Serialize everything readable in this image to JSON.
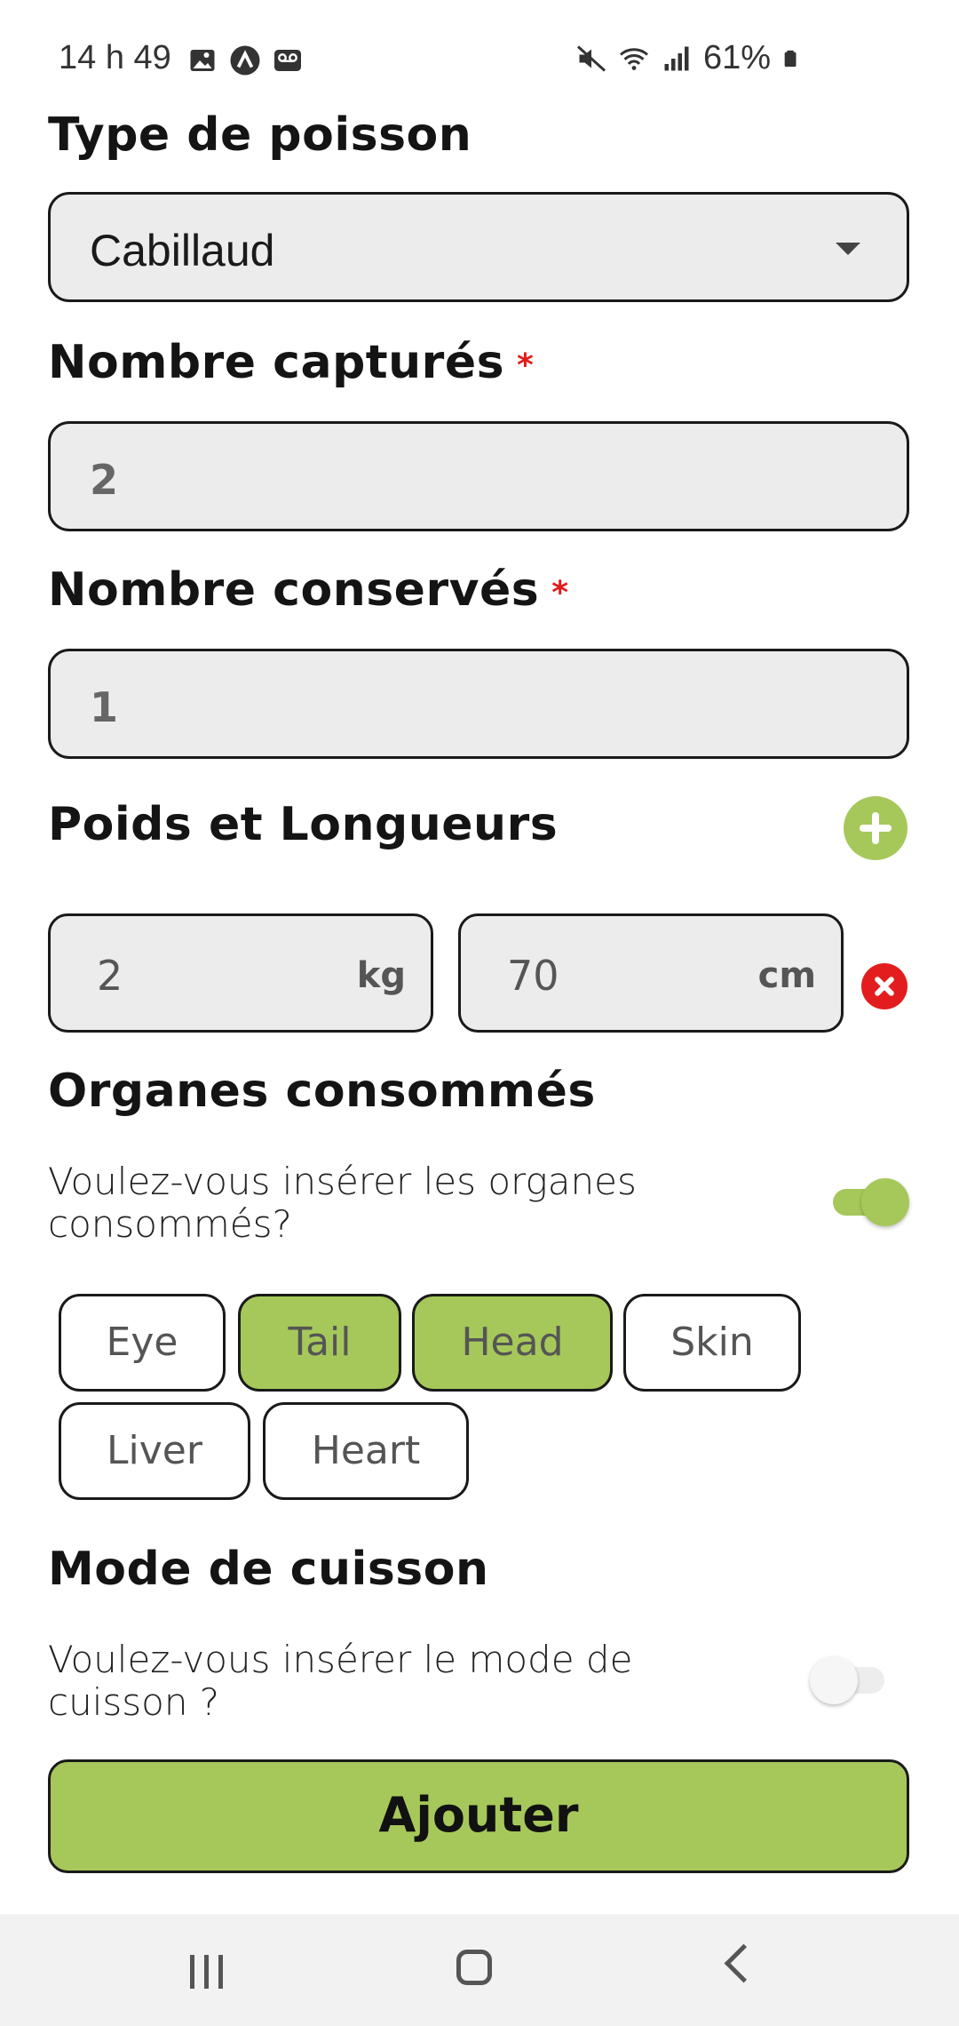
{
  "status_bar": {
    "time": "14 h 49",
    "battery": "61%",
    "left_icons": [
      "image-icon",
      "app-notification-icon",
      "voicemail-icon"
    ],
    "right_icons": [
      "mute-icon",
      "wifi-icon",
      "signal-icon",
      "battery-icon"
    ]
  },
  "fish_type": {
    "label": "Type de poisson",
    "selected": "Cabillaud"
  },
  "caught": {
    "label": "Nombre capturés",
    "required_mark": "*",
    "value": "2"
  },
  "kept": {
    "label": "Nombre conservés",
    "required_mark": "*",
    "value": "1"
  },
  "weights_lengths": {
    "label": "Poids et Longueurs",
    "entries": [
      {
        "weight": "2",
        "weight_unit": "kg",
        "length": "70",
        "length_unit": "cm"
      }
    ]
  },
  "organs": {
    "label": "Organes consommés",
    "question": "Voulez-vous insérer les organes consommés?",
    "toggle_on": true,
    "chips": [
      {
        "label": "Eye",
        "selected": false
      },
      {
        "label": "Tail",
        "selected": true
      },
      {
        "label": "Head",
        "selected": true
      },
      {
        "label": "Skin",
        "selected": false
      },
      {
        "label": "Liver",
        "selected": false
      },
      {
        "label": "Heart",
        "selected": false
      }
    ]
  },
  "cooking": {
    "label": "Mode de cuisson",
    "question": "Voulez-vous insérer le mode de cuisson ?",
    "toggle_on": false
  },
  "submit": {
    "label": "Ajouter"
  },
  "colors": {
    "accent": "#a6c85a",
    "required": "#e01b1b",
    "remove": "#e31d1d",
    "field_bg": "#ececec"
  }
}
